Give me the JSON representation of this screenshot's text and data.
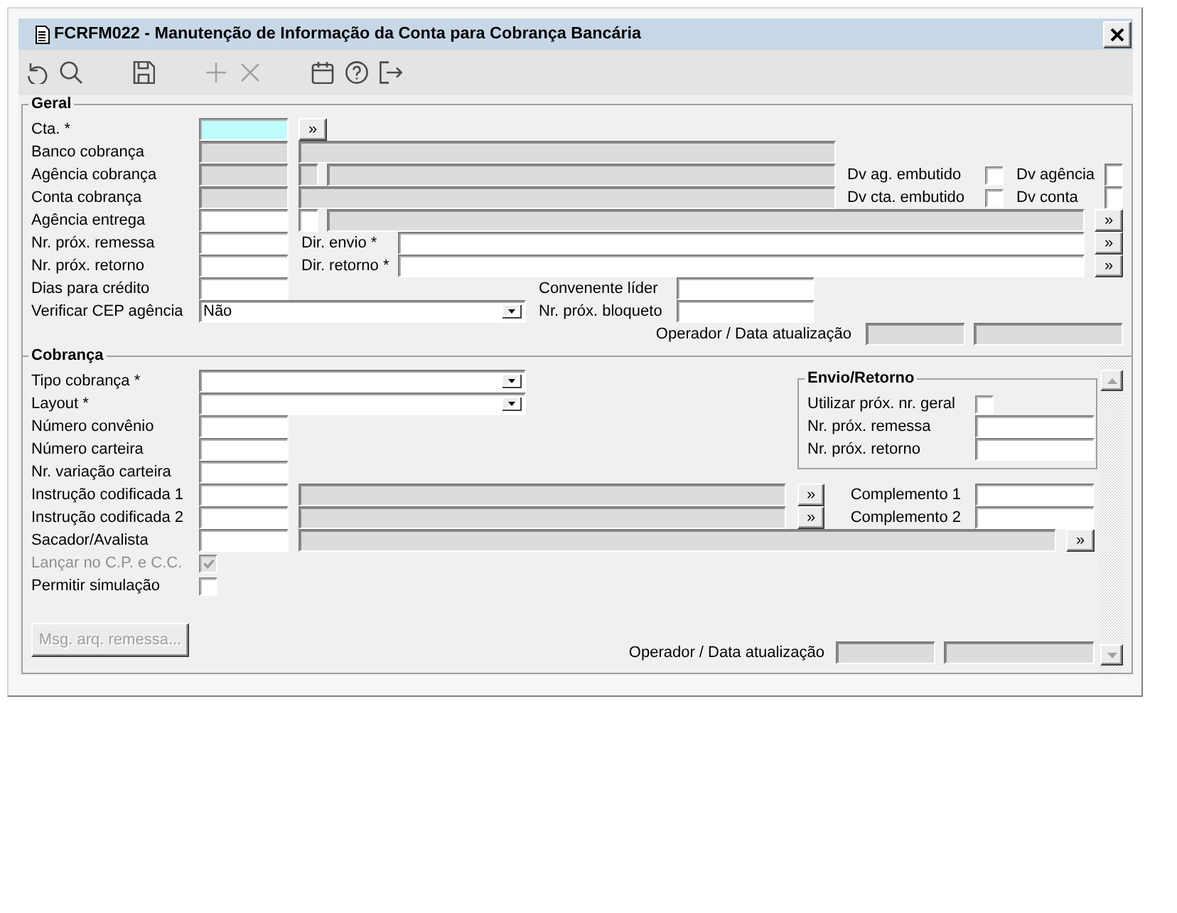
{
  "window": {
    "title": "FCRFM022 - Manutenção de Informação da Conta para Cobrança Bancária"
  },
  "toolbar": {
    "groups": [
      [
        {
          "kind": "undo",
          "disabled": false
        },
        {
          "kind": "search",
          "disabled": false
        }
      ],
      [
        {
          "kind": "save",
          "disabled": false
        }
      ],
      [
        {
          "kind": "add",
          "disabled": true
        },
        {
          "kind": "delete",
          "disabled": true
        }
      ],
      [
        {
          "kind": "calendar",
          "disabled": false
        },
        {
          "kind": "help",
          "disabled": false
        },
        {
          "kind": "exit",
          "disabled": false
        }
      ]
    ]
  },
  "geral": {
    "title": "Geral",
    "rows": [
      {
        "label": "Cta. *",
        "controls": [
          {
            "kind": "input",
            "readonly": false,
            "focused": true
          },
          {
            "kind": "lookup",
            "text": "»"
          }
        ]
      },
      {
        "label": "Banco cobrança",
        "controls": [
          {
            "kind": "input",
            "readonly": true,
            "focused": false
          },
          {
            "kind": "input",
            "readonly": true,
            "focused": false
          }
        ]
      },
      {
        "label": "Agência cobrança",
        "controls": [
          {
            "kind": "input",
            "readonly": true,
            "focused": false
          },
          {
            "kind": "input",
            "readonly": true,
            "focused": false
          },
          {
            "kind": "input",
            "readonly": true,
            "focused": false
          },
          {
            "kind": "label",
            "text": "Dv ag. embutido"
          },
          {
            "kind": "checkbox",
            "checked": false,
            "disabled": false
          },
          {
            "kind": "label",
            "text": "Dv agência"
          },
          {
            "kind": "input",
            "readonly": false,
            "focused": false
          }
        ]
      },
      {
        "label": "Conta cobrança",
        "controls": [
          {
            "kind": "input",
            "readonly": true,
            "focused": false
          },
          {
            "kind": "input",
            "readonly": true,
            "focused": false
          },
          {
            "kind": "label",
            "text": "Dv cta. embutido"
          },
          {
            "kind": "checkbox",
            "checked": false,
            "disabled": false
          },
          {
            "kind": "label",
            "text": "Dv conta"
          },
          {
            "kind": "input",
            "readonly": false,
            "focused": false
          }
        ]
      },
      {
        "label": "Agência entrega",
        "controls": [
          {
            "kind": "input",
            "readonly": false,
            "focused": false
          },
          {
            "kind": "input",
            "readonly": false,
            "focused": false
          },
          {
            "kind": "input",
            "readonly": true,
            "focused": false
          },
          {
            "kind": "lookup",
            "text": "»"
          }
        ]
      },
      {
        "label": "Nr. próx. remessa",
        "controls": [
          {
            "kind": "input",
            "readonly": false,
            "focused": false
          },
          {
            "kind": "label",
            "text": "Dir. envio *"
          },
          {
            "kind": "input",
            "readonly": false,
            "focused": false
          },
          {
            "kind": "lookup",
            "text": "»"
          }
        ]
      },
      {
        "label": "Nr. próx. retorno",
        "controls": [
          {
            "kind": "input",
            "readonly": false,
            "focused": false
          },
          {
            "kind": "label",
            "text": "Dir. retorno *"
          },
          {
            "kind": "input",
            "readonly": false,
            "focused": false
          },
          {
            "kind": "lookup",
            "text": "»"
          }
        ]
      },
      {
        "label": "Dias para crédito",
        "controls": [
          {
            "kind": "input",
            "readonly": false,
            "focused": false
          },
          {
            "kind": "label",
            "text": "Convenente líder"
          },
          {
            "kind": "input",
            "readonly": false,
            "focused": false
          }
        ]
      },
      {
        "label": "Verificar CEP agência",
        "controls": [
          {
            "kind": "combo",
            "value": "Não"
          },
          {
            "kind": "label",
            "text": "Nr. próx. bloqueto"
          },
          {
            "kind": "input",
            "readonly": false,
            "focused": false
          }
        ]
      },
      {
        "controls": [
          {
            "kind": "label",
            "text": "Operador / Data atualização"
          },
          {
            "kind": "input",
            "readonly": true,
            "focused": false
          },
          {
            "kind": "input",
            "readonly": true,
            "focused": false
          }
        ]
      }
    ]
  },
  "cobranca": {
    "title": "Cobrança",
    "rows": [
      {
        "label": "Tipo cobrança *",
        "controls": [
          {
            "kind": "combo"
          }
        ]
      },
      {
        "label": "Layout *",
        "controls": [
          {
            "kind": "combo"
          }
        ]
      },
      {
        "label": "Número convênio",
        "controls": [
          {
            "kind": "input",
            "readonly": false,
            "focused": false
          }
        ]
      },
      {
        "label": "Número carteira",
        "controls": [
          {
            "kind": "input",
            "readonly": false,
            "focused": false
          }
        ]
      },
      {
        "label": "Nr. variação carteira",
        "controls": [
          {
            "kind": "input",
            "readonly": false,
            "focused": false
          }
        ]
      },
      {
        "label": "Instrução codificada 1",
        "controls": [
          {
            "kind": "input",
            "readonly": false,
            "focused": false
          },
          {
            "kind": "input",
            "readonly": true,
            "focused": false
          },
          {
            "kind": "lookup",
            "text": "»"
          },
          {
            "kind": "label",
            "text": "Complemento 1"
          },
          {
            "kind": "input",
            "readonly": false,
            "focused": false
          }
        ]
      },
      {
        "label": "Instrução codificada 2",
        "controls": [
          {
            "kind": "input",
            "readonly": false,
            "focused": false
          },
          {
            "kind": "input",
            "readonly": true,
            "focused": false
          },
          {
            "kind": "lookup",
            "text": "»"
          },
          {
            "kind": "label",
            "text": "Complemento 2"
          },
          {
            "kind": "input",
            "readonly": false,
            "focused": false
          }
        ]
      },
      {
        "label": "Sacador/Avalista",
        "controls": [
          {
            "kind": "input",
            "readonly": false,
            "focused": false
          },
          {
            "kind": "input",
            "readonly": true,
            "focused": false
          },
          {
            "kind": "lookup",
            "text": "»"
          }
        ]
      },
      {
        "label": "Lançar no C.P. e C.C.",
        "controls": [
          {
            "kind": "checkbox",
            "checked": true,
            "disabled": true
          }
        ]
      },
      {
        "label": "Permitir simulação",
        "controls": [
          {
            "kind": "checkbox",
            "checked": false,
            "disabled": false
          }
        ]
      }
    ],
    "envio_retorno": {
      "title": "Envio/Retorno",
      "rows": [
        {
          "label": "Utilizar próx. nr. geral",
          "controls": [
            {
              "kind": "checkbox",
              "checked": false,
              "disabled": false
            }
          ]
        },
        {
          "label": "Nr. próx. remessa",
          "controls": [
            {
              "kind": "input",
              "readonly": false,
              "focused": false
            }
          ]
        },
        {
          "label": "Nr. próx. retorno",
          "controls": [
            {
              "kind": "input",
              "readonly": false,
              "focused": false
            }
          ]
        }
      ]
    },
    "button": {
      "label": "Msg. arq. remessa...",
      "disabled": true
    },
    "footer": {
      "controls": [
        {
          "kind": "label",
          "text": "Operador / Data atualização"
        },
        {
          "kind": "input",
          "readonly": true,
          "focused": false
        },
        {
          "kind": "input",
          "readonly": true,
          "focused": false
        }
      ]
    }
  }
}
